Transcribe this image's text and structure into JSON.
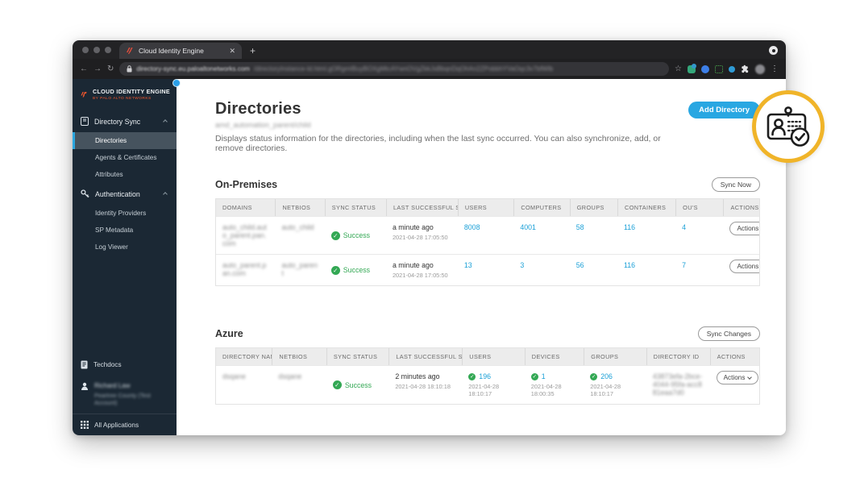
{
  "browser": {
    "tab_title": "Cloud Identity Engine",
    "url_host": "directory-sync.eu.paloaltonetworks.com",
    "url_path": "/directoryInstance-Id.html.gORgmIBuyBOXgMtcAYwnOVgZkkJsBbqnDqOhAn2ZPobbhYVaOqc3v7bfWlb"
  },
  "sidebar": {
    "logo_title": "CLOUD IDENTITY ENGINE",
    "logo_subtitle": "BY PALO ALTO NETWORKS",
    "sections": [
      {
        "label": "Directory Sync",
        "items": [
          "Directories",
          "Agents & Certificates",
          "Attributes"
        ]
      },
      {
        "label": "Authentication",
        "items": [
          "Identity Providers",
          "SP Metadata",
          "Log Viewer"
        ]
      }
    ],
    "active_item": "Directories",
    "techdocs_label": "Techdocs",
    "user_name": "Richard Law",
    "user_account": "Peartree County (Test Account)",
    "all_applications_label": "All Applications"
  },
  "main": {
    "title": "Directories",
    "subtitle_obscured": "amd_automation_parent/child",
    "description": "Displays status information for the directories, including when the last sync occurred. You can also synchronize, add, or remove directories.",
    "add_directory_label": "Add Directory",
    "onprem": {
      "title": "On-Premises",
      "sync_button": "Sync Now",
      "columns": [
        "Domains",
        "NetBIOS",
        "Sync Status",
        "Last Successful Sync",
        "Users",
        "Computers",
        "Groups",
        "Containers",
        "OU's",
        "Actions"
      ],
      "rows": [
        {
          "domain": "auto_child.auto_parent.pan.com",
          "netbios": "auto_child",
          "status": "Success",
          "last_sync_relative": "a minute ago",
          "last_sync_time": "2021-04-28 17:05:50",
          "users": "8008",
          "computers": "4001",
          "groups": "58",
          "containers": "116",
          "ous": "4",
          "actions": "Actions"
        },
        {
          "domain": "auto_parent.pan.com",
          "netbios": "auto_parent",
          "status": "Success",
          "last_sync_relative": "a minute ago",
          "last_sync_time": "2021-04-28 17:05:50",
          "users": "13",
          "computers": "3",
          "groups": "56",
          "containers": "116",
          "ous": "7",
          "actions": "Actions"
        }
      ]
    },
    "azure": {
      "title": "Azure",
      "sync_button": "Sync Changes",
      "columns": [
        "Directory Name",
        "NetBIOS",
        "Sync Status",
        "Last Successful Sync",
        "Users",
        "Devices",
        "Groups",
        "Directory ID",
        "Actions"
      ],
      "rows": [
        {
          "name": "dsqane",
          "netbios": "dsqane",
          "status": "Success",
          "last_sync_relative": "2 minutes ago",
          "last_sync_time": "2021-04-28 18:10:18",
          "users": "196",
          "users_time": "2021-04-28 18:10:17",
          "devices": "1",
          "devices_time": "2021-04-28 18:00:35",
          "groups": "206",
          "groups_time": "2021-04-28 18:10:17",
          "directory_id": "43873efa-2bce-4044-95fa-acc881eaa7d0",
          "actions": "Actions"
        }
      ]
    }
  },
  "colors": {
    "accent_blue": "#29a7e2",
    "link_blue": "#1ba0d7",
    "success_green": "#33a854",
    "highlight_yellow": "#f0b429",
    "brand_red": "#fa582d",
    "sidebar_bg": "#1b2834"
  }
}
